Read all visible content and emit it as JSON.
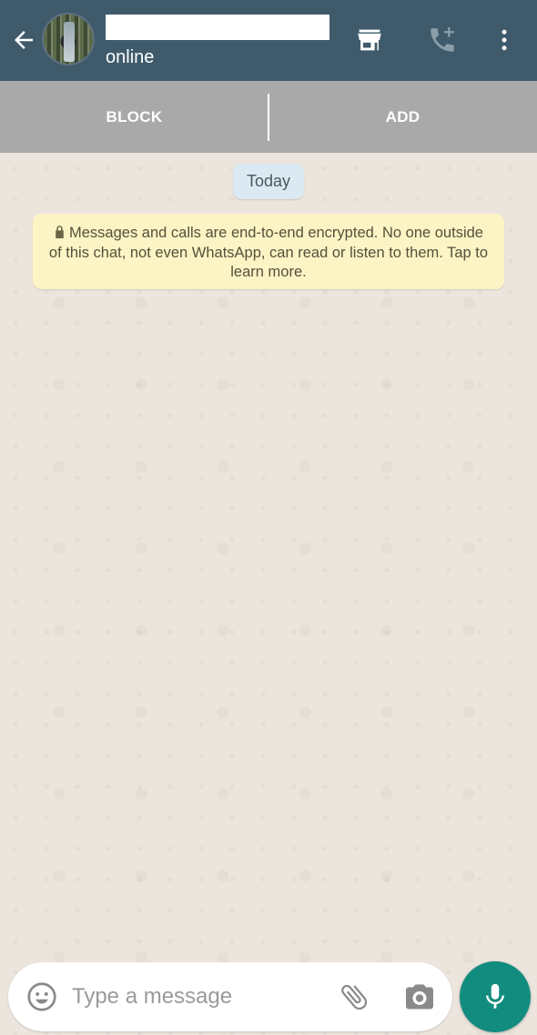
{
  "header": {
    "contact_name": "",
    "status": "online",
    "icons": [
      "back-arrow-icon",
      "store-icon",
      "add-call-icon",
      "more-vert-icon"
    ]
  },
  "action_bar": {
    "block_label": "BLOCK",
    "add_label": "ADD"
  },
  "chat": {
    "date_label": "Today",
    "encryption_notice": "Messages and calls are end-to-end encrypted. No one outside of this chat, not even WhatsApp, can read or listen to them. Tap to learn more."
  },
  "composer": {
    "placeholder": "Type a message",
    "value": "",
    "icons": [
      "emoji-icon",
      "attach-icon",
      "camera-icon",
      "mic-icon"
    ]
  },
  "colors": {
    "header": "#3f5b6b",
    "action_bar": "#a9a9a9",
    "chat_background": "#ece5dd",
    "date_chip": "#dbeaf2",
    "notice_background": "#fdf4c5",
    "accent": "#128c7e"
  }
}
